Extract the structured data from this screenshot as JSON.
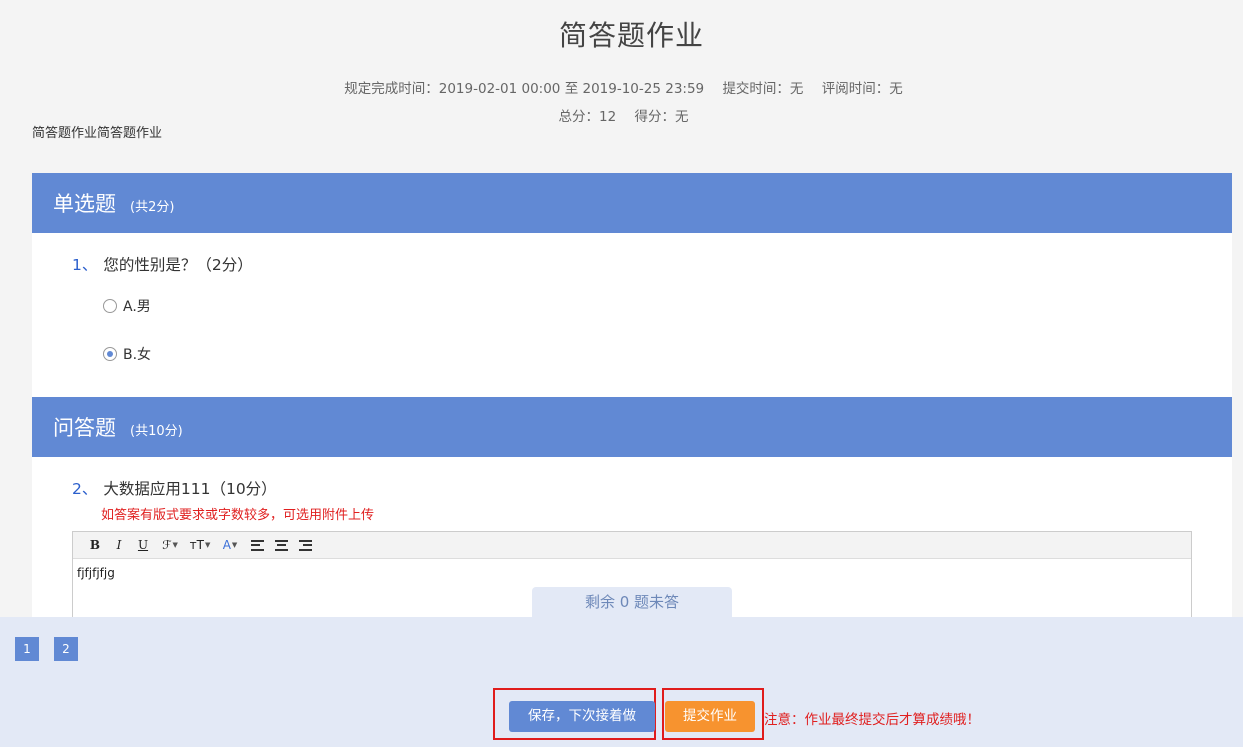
{
  "page": {
    "title": "简答题作业",
    "meta": {
      "deadline": "规定完成时间：2019-02-01 00:00 至 2019-10-25 23:59",
      "submit_time": "提交时间：无",
      "review_time": "评阅时间：无",
      "total_score": "总分：12",
      "obtained_score": "得分：无"
    },
    "description": "简答题作业简答题作业"
  },
  "sections": [
    {
      "name": "单选题",
      "score": "(共2分)",
      "question": {
        "number": "1、",
        "text": "您的性别是？（2分）",
        "options": [
          {
            "label": "A.男",
            "selected": false
          },
          {
            "label": "B.女",
            "selected": true
          }
        ]
      }
    },
    {
      "name": "问答题",
      "score": "(共10分)",
      "question": {
        "number": "2、",
        "text": "大数据应用111（10分）",
        "hint": "如答案有版式要求或字数较多，可选用附件上传",
        "answer": "fjfjfjfjg"
      }
    }
  ],
  "editor_toolbar": [
    {
      "name": "bold-button",
      "glyph": "B"
    },
    {
      "name": "italic-button",
      "glyph": "I"
    },
    {
      "name": "underline-button",
      "glyph": "U"
    },
    {
      "name": "font-family-button",
      "glyph": "ℱ"
    },
    {
      "name": "font-size-button",
      "glyph": "ᴛT"
    },
    {
      "name": "font-color-button",
      "glyph": "A"
    },
    {
      "name": "align-left-button",
      "glyph": ""
    },
    {
      "name": "align-center-button",
      "glyph": ""
    },
    {
      "name": "align-right-button",
      "glyph": ""
    }
  ],
  "remaining": "剩余 0 题未答",
  "pagination": [
    "1",
    "2"
  ],
  "actions": {
    "save_label": "保存，下次接着做",
    "submit_label": "提交作业",
    "notice": "注意：作业最终提交后才算成绩哦！"
  },
  "colors": {
    "section_header": "#6189d4",
    "save_button": "#6189d4",
    "submit_button": "#f7932f",
    "warning_text": "#e02020",
    "highlight_box": "#e01c1c"
  }
}
